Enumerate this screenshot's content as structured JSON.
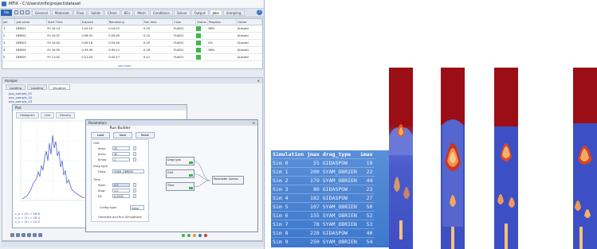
{
  "app": {
    "title": "MFIX - C:\\Users\\mfix\\project\\dataset"
  },
  "ribbon": {
    "file_label": "File",
    "tabs": [
      "General",
      "Materials",
      "Flow",
      "Solids",
      "Chem",
      "BCs",
      "Mesh",
      "Conditions",
      "Solver",
      "Output",
      "Jobs",
      "Sampling"
    ],
    "active_tab": 10
  },
  "jobs_grid": {
    "columns": [
      "Job",
      "Job name",
      "Start Time",
      "Elapsed",
      "Remaining",
      "Sim time",
      "Case",
      "Status",
      "Progress",
      "Owner"
    ],
    "rows": [
      [
        "1",
        "DEM01",
        "Fri 10:14",
        "1:02:10",
        "0:14:22",
        "0.25",
        "FLUID1",
        "",
        "98%",
        "Queued"
      ],
      [
        "2",
        "DEM02",
        "Fri 10:22",
        "0:58:31",
        "0:20:05",
        "0.22",
        "FLUID1",
        "",
        "",
        "Queued"
      ],
      [
        "3",
        "DEM03",
        "Fri 10:40",
        "0:45:18",
        "0:25:40",
        "0.20",
        "FLUID1",
        "",
        "0%",
        "Queued"
      ],
      [
        "4",
        "DEM04",
        "Fri 10:55",
        "0:33:49",
        "0:30:11",
        "0.18",
        "FLUID1",
        "",
        "98%",
        "Queued"
      ],
      [
        "5",
        "DEM05",
        "Fri 11:02",
        "0:21:03",
        "0:42:17",
        "0.12",
        "FLUID1",
        "",
        "",
        "Queued"
      ]
    ],
    "link_text": "see more"
  },
  "lower_pane": {
    "title": "Analyze",
    "close": "✕",
    "subtabs": [
      "Loading",
      "Loading",
      "Visualize"
    ],
    "tree": [
      "pos_sample_01",
      "pos_sample_02",
      "pos_sample_03"
    ],
    "plot_window": {
      "title": "Plot",
      "toolbar": [
        "Histogram",
        "Line",
        "Density"
      ],
      "legend": [
        "ε_s = (0) = 26.8",
        "ε_s = (1) = 18.4",
        "ε_s = (2) = 14.0"
      ]
    }
  },
  "dialog": {
    "title": "Parameters",
    "close": "✕",
    "run_name": "Run Builder",
    "buttons": [
      "Load",
      "Save",
      "Reset"
    ],
    "sections": [
      "Grid",
      "Drag type",
      "Time"
    ],
    "fields": [
      {
        "label": "Imax:",
        "value": "55"
      },
      {
        "label": "Jmax:",
        "value": "40"
      },
      {
        "label": "Kmax:",
        "value": "1"
      },
      {
        "label": "Drag:",
        "value": "SYAM_OBRIEN"
      },
      {
        "label": "Start:",
        "value": "0.0"
      },
      {
        "label": "Stop:",
        "value": "1.0"
      },
      {
        "label": "Dt:",
        "value": "0.0005"
      }
    ],
    "config_label": "Config type:",
    "config_value": "Sobol",
    "footer": "Generate and Run Simulations",
    "nodes": [
      "Drag type",
      "Grid",
      "Time",
      "Parameter Combo"
    ]
  },
  "sim_table": {
    "columns": [
      "Simulation",
      "jmax",
      "drag_type",
      "imax"
    ],
    "rows": [
      [
        "Sim 0",
        "55",
        "GIDASPOW",
        "19"
      ],
      [
        "Sim 1",
        "200",
        "SYAM_OBRIEN",
        "22"
      ],
      [
        "Sim 2",
        "179",
        "SYAM_OBRIEN",
        "44"
      ],
      [
        "Sim 3",
        "80",
        "GIDASPOW",
        "23"
      ],
      [
        "Sim 4",
        "182",
        "GIDASPOW",
        "27"
      ],
      [
        "Sim 5",
        "107",
        "SYAM_OBRIEN",
        "50"
      ],
      [
        "Sim 6",
        "155",
        "SYAM_OBRIEN",
        "52"
      ],
      [
        "Sim 7",
        "78",
        "SYAM_OBRIEN",
        "53"
      ],
      [
        "Sim 8",
        "228",
        "GIDASPOW",
        "40"
      ],
      [
        "Sim 9",
        "250",
        "SYAM_OBRIEN",
        "54"
      ]
    ]
  },
  "colors": {
    "ribbon_file": "#2f62b1",
    "status_green": "#41b649",
    "bed_top": "#9c0e16",
    "bed_bottom": "#3d4fc4",
    "bubble": "#f2a35c"
  }
}
